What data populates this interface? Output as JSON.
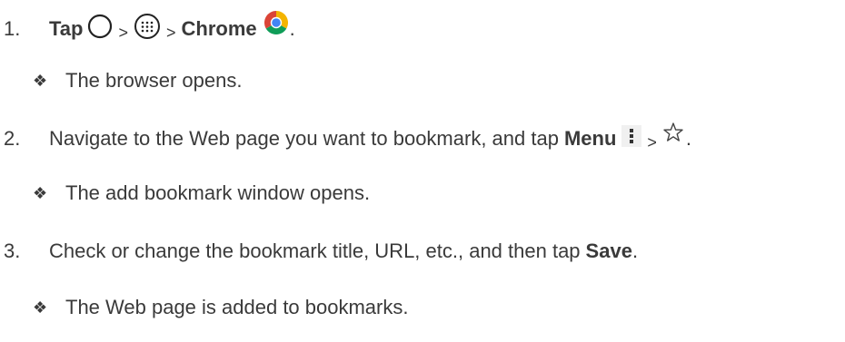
{
  "steps": [
    {
      "number": "1.",
      "tap_word": "Tap",
      "separator": ">",
      "app_name": "Chrome",
      "end_punct": ".",
      "result": "The browser opens.",
      "icons": [
        "home-circle-icon",
        "apps-grid-icon",
        "chrome-logo-icon"
      ]
    },
    {
      "number": "2.",
      "text": "Navigate to the Web page you want to bookmark, and tap",
      "menu_word": "Menu",
      "separator": ">",
      "end_punct": ".",
      "result": "The add bookmark window opens.",
      "icons": [
        "overflow-menu-icon",
        "star-outline-icon"
      ]
    },
    {
      "number": "3.",
      "text": "Check or change the bookmark title, URL, etc., and then tap",
      "save_word": "Save",
      "end_punct": ".",
      "result": "The Web page is added to bookmarks."
    }
  ],
  "bullet_glyph": "❖",
  "colors": {
    "text": "#3a3a3a",
    "chrome_red": "#db4437",
    "chrome_green": "#0f9d58",
    "chrome_yellow": "#f4b400",
    "chrome_blue": "#4285f4"
  }
}
